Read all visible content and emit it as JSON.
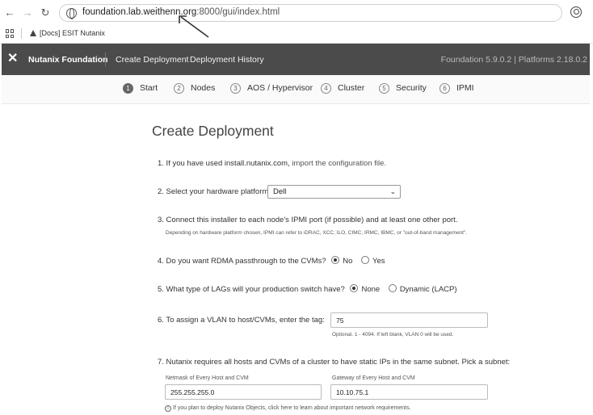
{
  "browser": {
    "url_host": "foundation.lab.weithenn.org",
    "url_rest": ":8000/gui/index.html",
    "bookmark": "[Docs] ESIT Nutanix"
  },
  "header": {
    "brand": "Nutanix Foundation",
    "nav": [
      "Create Deployment",
      "Deployment History"
    ],
    "version": "Foundation 5.9.0.2 | Platforms 2.18.0.2"
  },
  "steps": [
    {
      "num": "1",
      "label": "Start"
    },
    {
      "num": "2",
      "label": "Nodes"
    },
    {
      "num": "3",
      "label": "AOS / Hypervisor"
    },
    {
      "num": "4",
      "label": "Cluster"
    },
    {
      "num": "5",
      "label": "Security"
    },
    {
      "num": "6",
      "label": "IPMI"
    }
  ],
  "page": {
    "title": "Create Deployment",
    "q1_prefix": "1. If you have used install.nutanix.com,",
    "q1_link": "import the configuration file.",
    "q2": "2. Select your hardware platform:",
    "q2_value": "Dell",
    "q3": "3. Connect this installer to each node's IPMI port (if possible) and at least one other port.",
    "q3_note": "Depending on hardware platform chosen, IPMI can refer to iDRAC, XCC, ILO, CIMC, IRMC, IBMC, or \"out-of-band management\".",
    "q4": "4. Do you want RDMA passthrough to the CVMs?",
    "q4_opt1": "No",
    "q4_opt2": "Yes",
    "q5": "5. What type of LAGs will your production switch have?",
    "q5_opt1": "None",
    "q5_opt2": "Dynamic (LACP)",
    "q6": "6. To assign a VLAN to host/CVMs, enter the tag:",
    "q6_value": "75",
    "q6_note": "Optional. 1 - 4094. If left blank, VLAN 0 will be used.",
    "q7": "7. Nutanix requires all hosts and CVMs of a cluster to have static IPs in the same subnet. Pick a subnet:",
    "netmask_label": "Netmask of Every Host and CVM",
    "netmask_value": "255.255.255.0",
    "gateway_label": "Gateway of Every Host and CVM",
    "gateway_value": "10.10.75.1",
    "objects_note": "If you plan to deploy Nutanix Objects, click here to learn about important network requirements."
  }
}
